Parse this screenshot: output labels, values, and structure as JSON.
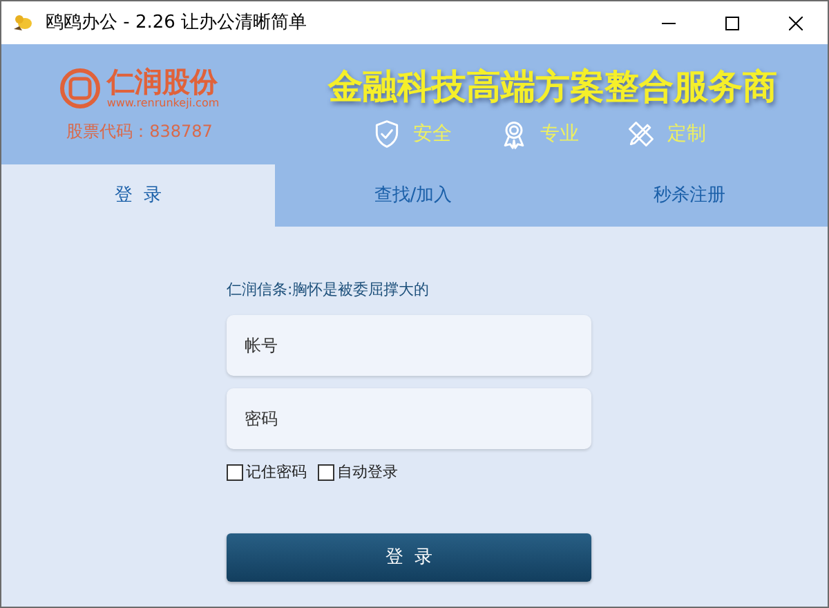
{
  "window": {
    "title": "鸥鸥办公 - 2.26 让办公清晰简单"
  },
  "brand": {
    "name": "仁润股份",
    "url": "www.renrunkeji.com",
    "stock_code": "股票代码：838787"
  },
  "banner": {
    "slogan": "金融科技高端方案整合服务商",
    "features": [
      {
        "kind": "shield",
        "label": "安全"
      },
      {
        "kind": "award",
        "label": "专业"
      },
      {
        "kind": "tools",
        "label": "定制"
      }
    ]
  },
  "tabs": [
    {
      "label": "登  录",
      "selected": true
    },
    {
      "label": "查找/加入",
      "selected": false
    },
    {
      "label": "秒杀注册",
      "selected": false
    }
  ],
  "motto": "仁润信条:胸怀是被委屈撑大的",
  "account": {
    "placeholder": "帐号"
  },
  "password": {
    "placeholder": "密码"
  },
  "options": [
    {
      "label": "记住密码",
      "checked": false
    },
    {
      "label": "自动登录",
      "checked": false
    }
  ],
  "login_button": "登  录"
}
